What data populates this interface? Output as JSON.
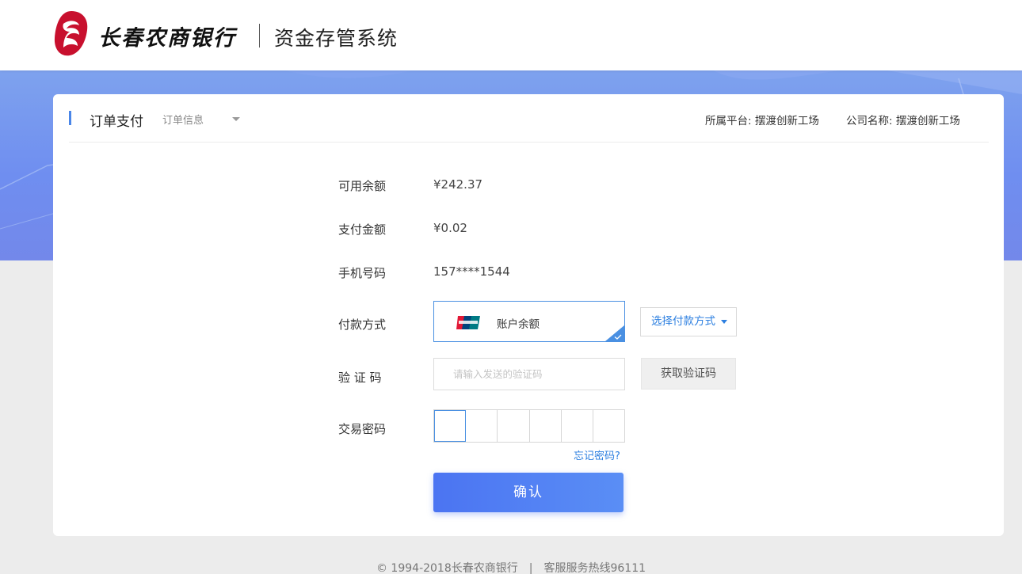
{
  "header": {
    "brand_name": "长春农商银行",
    "system_name": "资金存管系统"
  },
  "card": {
    "title": "订单支付",
    "order_info": "订单信息",
    "platform": "所属平台: 摆渡创新工场",
    "company": "公司名称: 摆渡创新工场"
  },
  "form": {
    "available_label": "可用余额",
    "available_value": "¥242.37",
    "amount_label": "支付金额",
    "amount_value": "¥0.02",
    "phone_label": "手机号码",
    "phone_value": "157****1544",
    "method_label": "付款方式",
    "method_value": "账户余额",
    "choose_method": "选择付款方式",
    "code_label": "验 证 码",
    "code_placeholder": "请输入发送的验证码",
    "get_code": "获取验证码",
    "password_label": "交易密码",
    "forgot_password": "忘记密码?",
    "confirm": "确认"
  },
  "footer": {
    "copyright": "© 1994-2018长春农商银行",
    "separator": "|",
    "hotline": "客服服务热线96111"
  },
  "colors": {
    "accent": "#4a90e2",
    "link": "#2c7fe0",
    "brand_red": "#c8102e",
    "banner": "#7a98ee"
  }
}
